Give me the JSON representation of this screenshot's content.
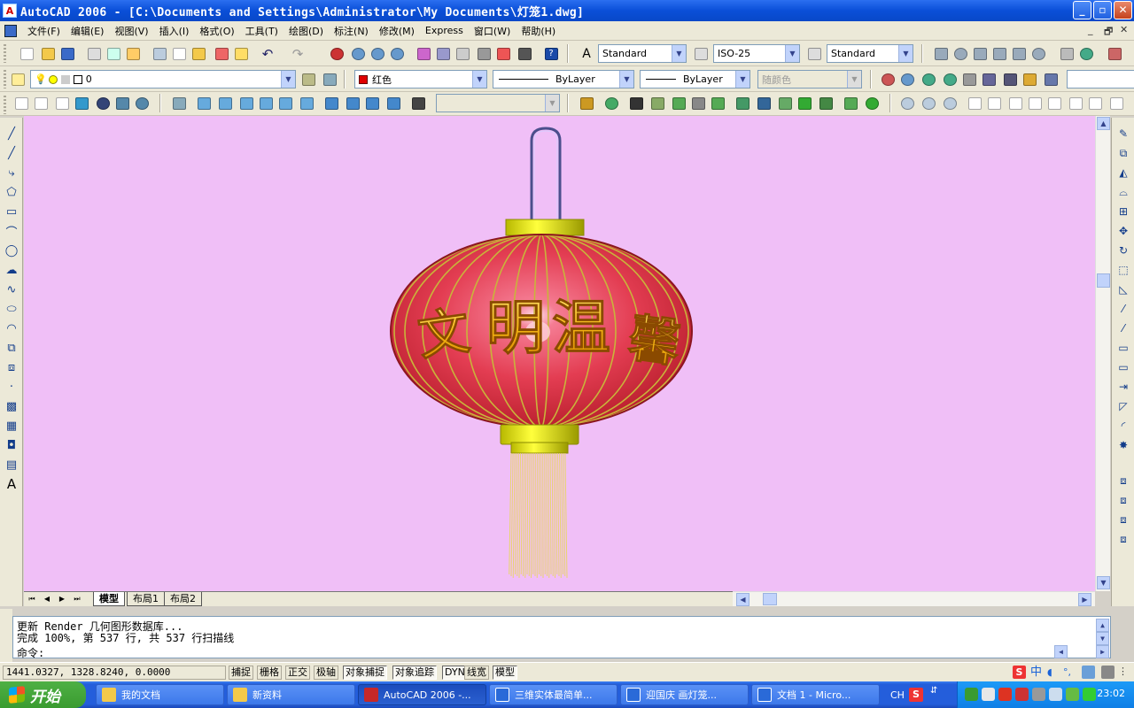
{
  "window": {
    "title": "AutoCAD 2006 - [C:\\Documents and Settings\\Administrator\\My Documents\\灯笼1.dwg]",
    "app_icon_text": "A"
  },
  "menu": [
    "文件(F)",
    "编辑(E)",
    "视图(V)",
    "插入(I)",
    "格式(O)",
    "工具(T)",
    "绘图(D)",
    "标注(N)",
    "修改(M)",
    "Express",
    "窗口(W)",
    "帮助(H)"
  ],
  "styles_toolbar": {
    "text_style": "Standard",
    "dim_style": "ISO-25",
    "table_style": "Standard"
  },
  "layers_toolbar": {
    "layer": "0",
    "color": "红色",
    "color_hex": "#e00000",
    "linetype": "ByLayer",
    "lineweight": "ByLayer",
    "plotstyle": "随颜色"
  },
  "drawing": {
    "background_color": "#f0bff7",
    "lantern_text": [
      "文",
      "明",
      "温",
      "馨"
    ],
    "lantern_body_color": "#e33d52",
    "cap_color": "#e6e600",
    "tassel_color": "#e8d66a"
  },
  "layout_tabs": [
    {
      "label": "模型",
      "active": true
    },
    {
      "label": "布局1",
      "active": false
    },
    {
      "label": "布局2",
      "active": false
    }
  ],
  "command": {
    "line1": "更新 Render 几何图形数据库...",
    "line2": "完成 100%, 第 537 行, 共 537 行扫描线",
    "prompt": "命令:"
  },
  "status": {
    "coords": "1441.0327, 1328.8240, 0.0000",
    "toggles": [
      {
        "label": "捕捉",
        "on": false
      },
      {
        "label": "栅格",
        "on": false
      },
      {
        "label": "正交",
        "on": false
      },
      {
        "label": "极轴",
        "on": false
      },
      {
        "label": "对象捕捉",
        "on": true
      },
      {
        "label": "对象追踪",
        "on": true
      },
      {
        "label": "DYN",
        "on": true
      },
      {
        "label": "线宽",
        "on": false
      },
      {
        "label": "模型",
        "on": true
      }
    ]
  },
  "taskbar": {
    "start_label": "开始",
    "tasks": [
      {
        "label": "我的文档",
        "icon_color": "#f3c94a",
        "active": false
      },
      {
        "label": "新资料",
        "icon_color": "#f3c94a",
        "active": false
      },
      {
        "label": "AutoCAD 2006 -...",
        "icon_color": "#c62828",
        "active": true
      },
      {
        "label": "三维实体最简单...",
        "icon_color": "#2a6ad8",
        "active": false
      },
      {
        "label": "迎国庆 画灯笼...",
        "icon_color": "#2a6ad8",
        "active": false
      },
      {
        "label": "文档 1 - Micro...",
        "icon_color": "#2a6ad8",
        "active": false
      }
    ],
    "lang": "CH",
    "clock": "23:02"
  }
}
